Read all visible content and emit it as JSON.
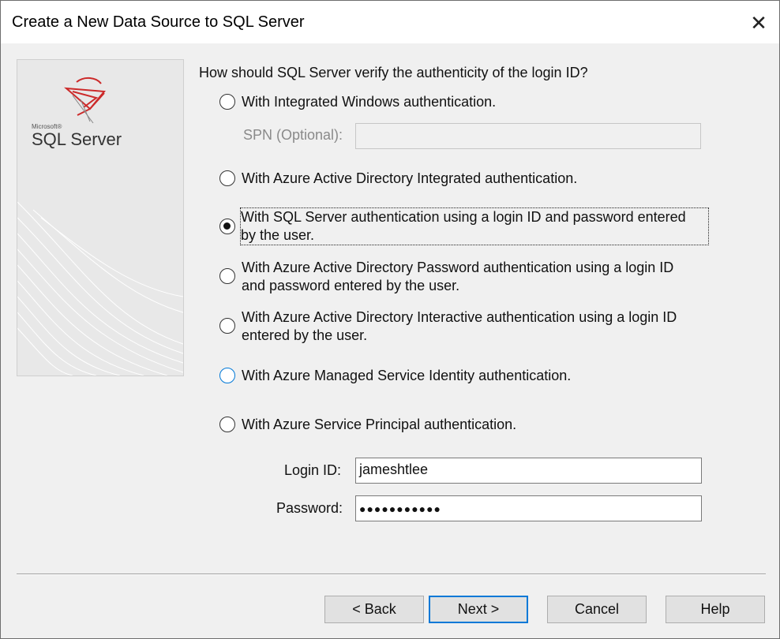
{
  "window": {
    "title": "Create a New Data Source to SQL Server",
    "close_glyph": "✕"
  },
  "logo": {
    "microsoft": "Microsoft®",
    "product": "SQL Server"
  },
  "question": "How should SQL Server verify the authenticity of the login ID?",
  "options": [
    {
      "label": "With Integrated Windows authentication.",
      "checked": false
    },
    {
      "label": "With Azure Active Directory Integrated authentication.",
      "checked": false
    },
    {
      "label_line1": "With SQL Server authentication using a login ID and password entered",
      "label_line2": "by the user.",
      "checked": true
    },
    {
      "label_line1": "With Azure Active Directory Password authentication using a login ID",
      "label_line2": "and password entered by the user.",
      "checked": false
    },
    {
      "label_line1": "With Azure Active Directory Interactive authentication using a login ID",
      "label_line2": "entered by the user.",
      "checked": false
    },
    {
      "label": "With Azure Managed Service Identity authentication.",
      "checked": false
    },
    {
      "label": "With Azure Service Principal authentication.",
      "checked": false
    }
  ],
  "spn": {
    "label": "SPN (Optional):",
    "value": ""
  },
  "login": {
    "label": "Login ID:",
    "value": "jameshtlee"
  },
  "password": {
    "label": "Password:",
    "value": "●●●●●●●●●●●"
  },
  "buttons": {
    "back": "< Back",
    "next": "Next >",
    "cancel": "Cancel",
    "help": "Help"
  },
  "colors": {
    "accent": "#0078d7",
    "logo_red": "#cc2a2a"
  }
}
